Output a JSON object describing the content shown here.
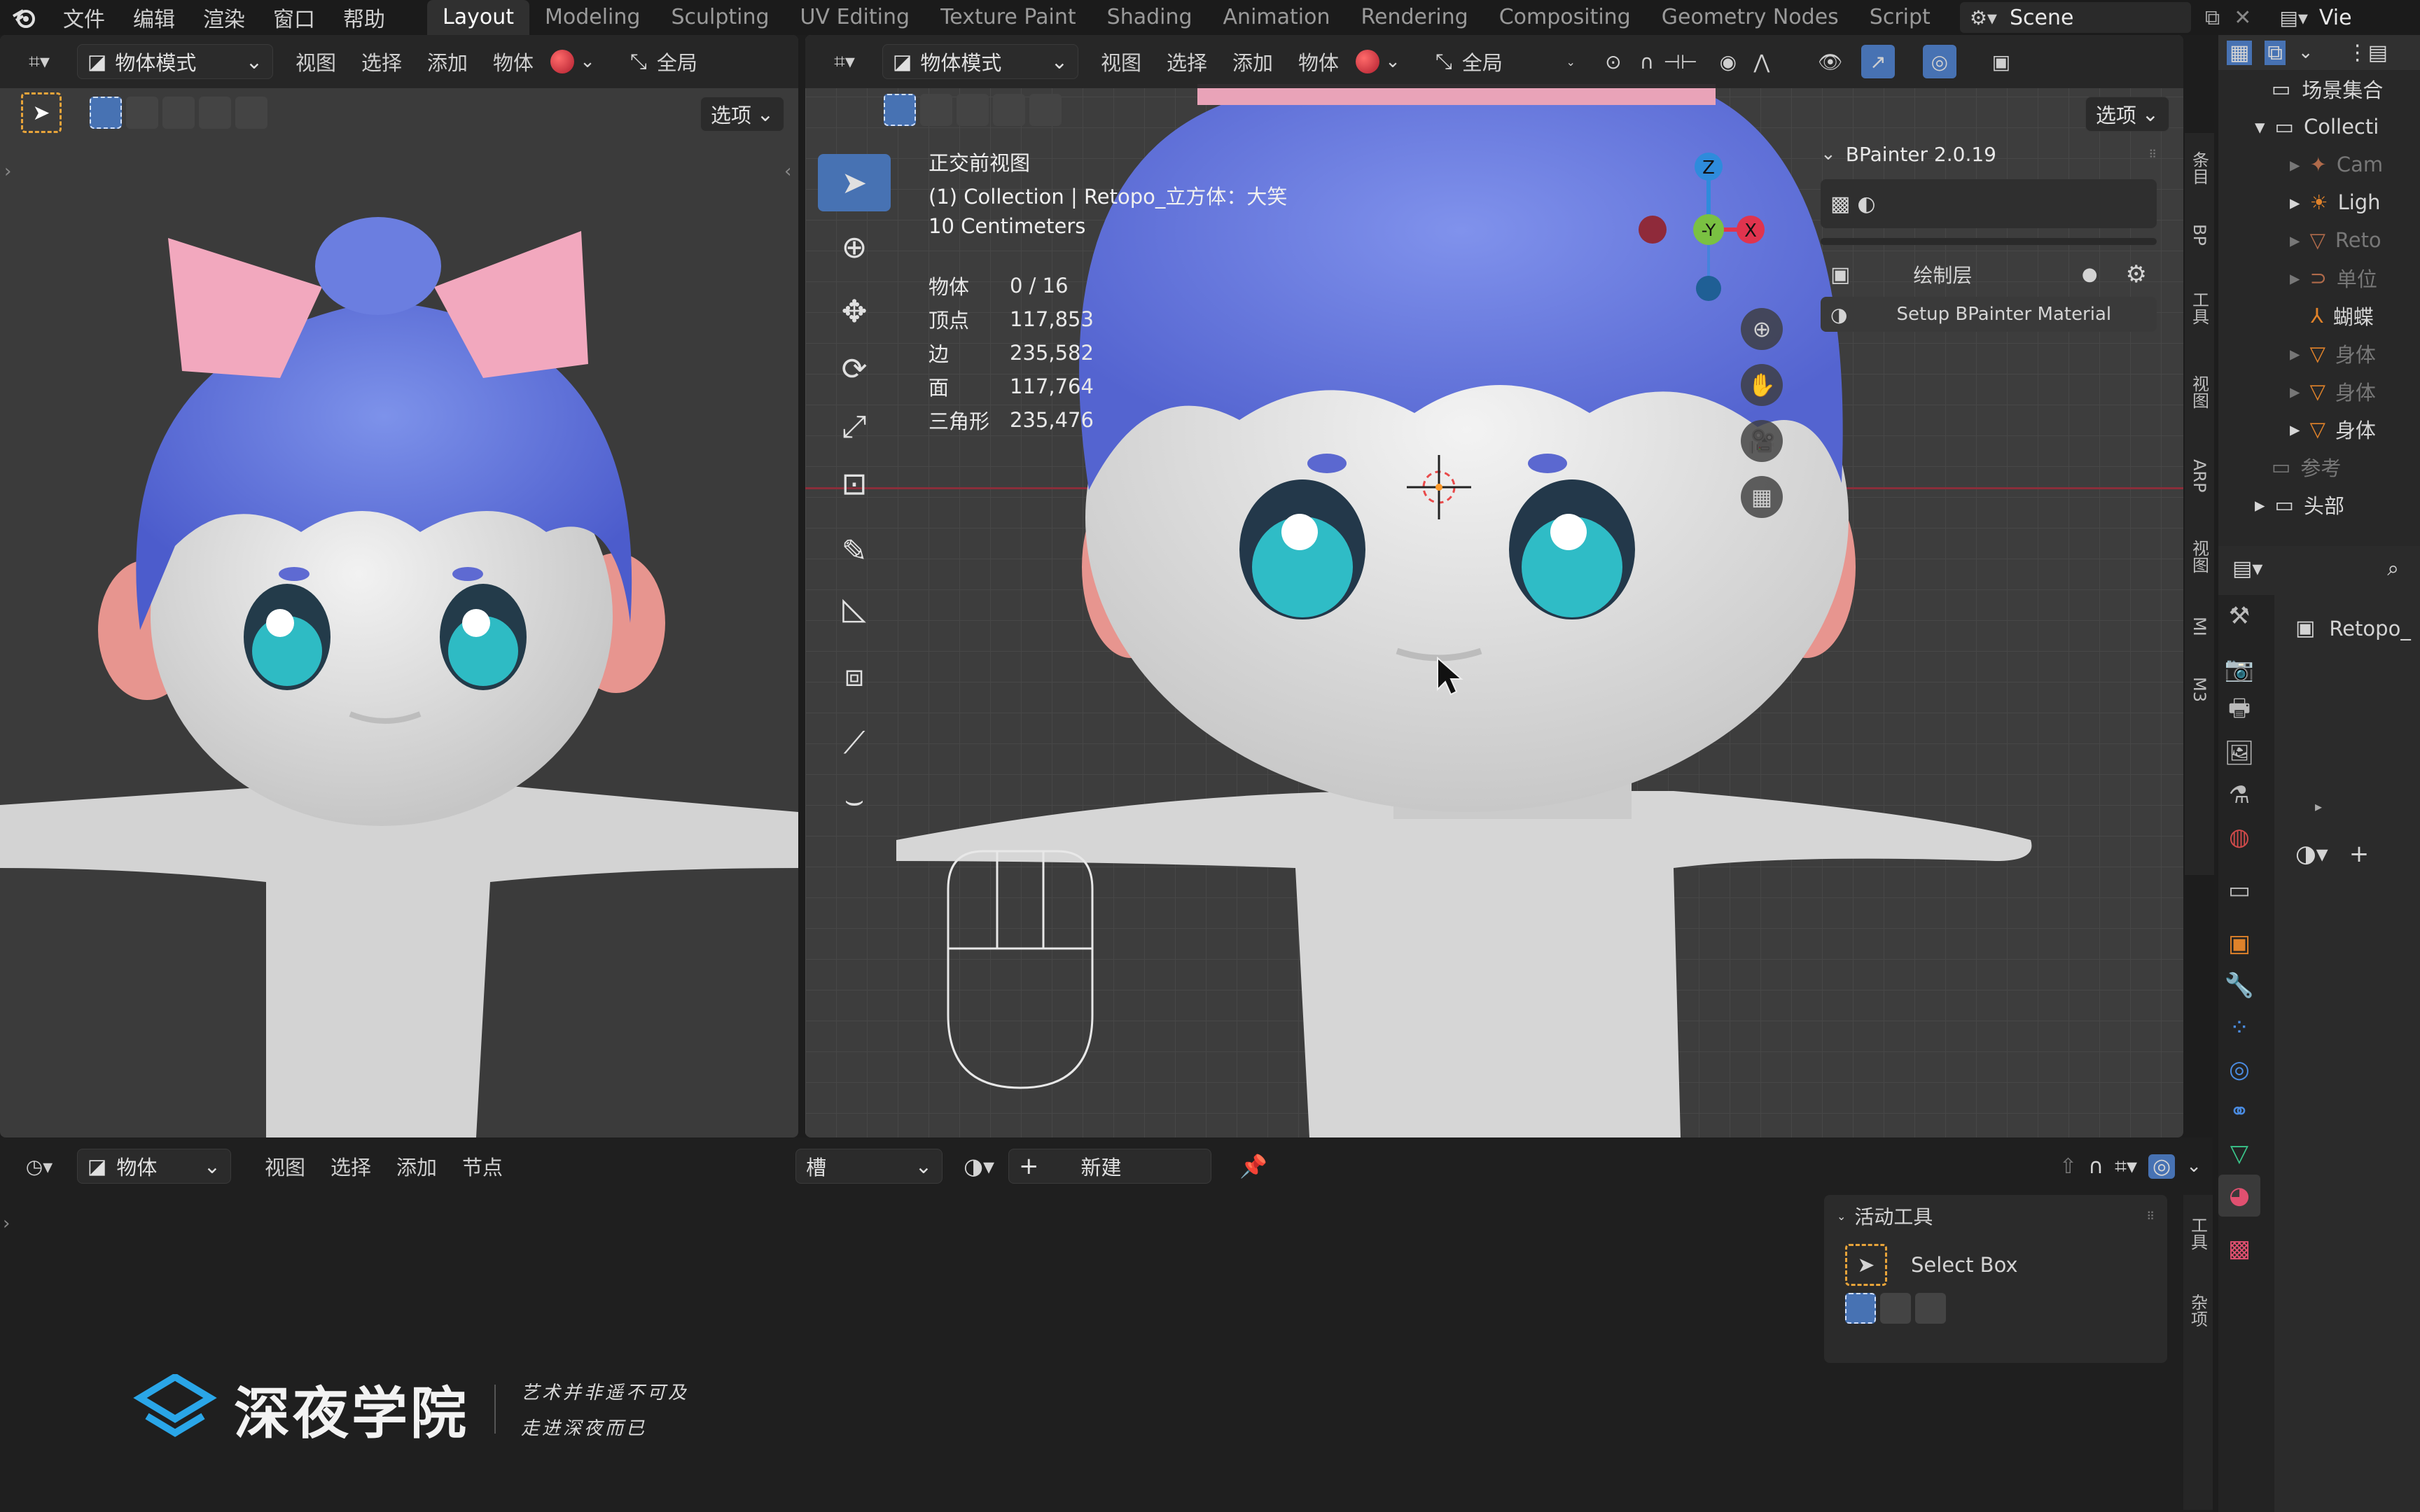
{
  "topbar": {
    "menus": [
      "文件",
      "编辑",
      "渲染",
      "窗口",
      "帮助"
    ],
    "workspaces": [
      "Layout",
      "Modeling",
      "Sculpting",
      "UV Editing",
      "Texture Paint",
      "Shading",
      "Animation",
      "Rendering",
      "Compositing",
      "Geometry Nodes",
      "Script"
    ],
    "active_workspace": "Layout",
    "scene_label": "Scene",
    "view_layer_label": "Vie"
  },
  "left_viewport": {
    "mode": "物体模式",
    "menus": [
      "视图",
      "选择",
      "添加",
      "物体"
    ],
    "transform": "全局",
    "options": "选项"
  },
  "main_viewport": {
    "mode": "物体模式",
    "menus": [
      "视图",
      "选择",
      "添加",
      "物体"
    ],
    "transform": "全局",
    "options": "选项",
    "overlay": {
      "view_name": "正交前视图",
      "collection": "(1) Collection | Retopo_立方体：大笑",
      "scale": "10 Centimeters"
    },
    "stats": [
      {
        "label": "物体",
        "value": "0 / 16"
      },
      {
        "label": "顶点",
        "value": "117,853"
      },
      {
        "label": "边",
        "value": "235,582"
      },
      {
        "label": "面",
        "value": "117,764"
      },
      {
        "label": "三角形",
        "value": "235,476"
      }
    ],
    "gizmo": {
      "z": "Z",
      "y": "-Y",
      "x": "X"
    }
  },
  "bpainter": {
    "title": "BPainter 2.0.19",
    "layer_label": "绘制层",
    "setup_button": "Setup BPainter Material"
  },
  "side_tabs": [
    "条目",
    "BP",
    "工具",
    "视图",
    "ARP",
    "视图",
    "MI",
    "M3"
  ],
  "outliner": {
    "scene_collection": "场景集合",
    "rows": [
      {
        "label": "Collecti",
        "color": "#d0d0d0"
      },
      {
        "label": "Cam",
        "color": "#777777"
      },
      {
        "label": "Ligh",
        "color": "#d0d0d0"
      },
      {
        "label": "Reto",
        "color": "#777777"
      },
      {
        "label": "单位",
        "color": "#777777"
      },
      {
        "label": "蝴蝶",
        "color": "#d0d0d0"
      },
      {
        "label": "身体",
        "color": "#777777"
      },
      {
        "label": "身体",
        "color": "#777777"
      },
      {
        "label": "身体",
        "color": "#d0d0d0"
      },
      {
        "label": "参考",
        "color": "#777777"
      },
      {
        "label": "头部",
        "color": "#d0d0d0"
      }
    ]
  },
  "properties": {
    "object_name": "Retopo_"
  },
  "node_editor": {
    "type": "物体",
    "menus": [
      "视图",
      "选择",
      "添加",
      "节点"
    ],
    "slot": "槽",
    "new_button": "新建"
  },
  "active_tool": {
    "title": "活动工具",
    "tool_name": "Select Box",
    "side_tabs": [
      "工具",
      "杂项"
    ]
  },
  "watermark": {
    "brand": "深夜学院",
    "line1": "艺术并非遥不可及",
    "line2": "走进深夜而已"
  },
  "colors": {
    "accent": "#4772b3",
    "gizmo_x": "#e0344e",
    "gizmo_y": "#7ac142",
    "gizmo_z": "#2e8bdc"
  }
}
